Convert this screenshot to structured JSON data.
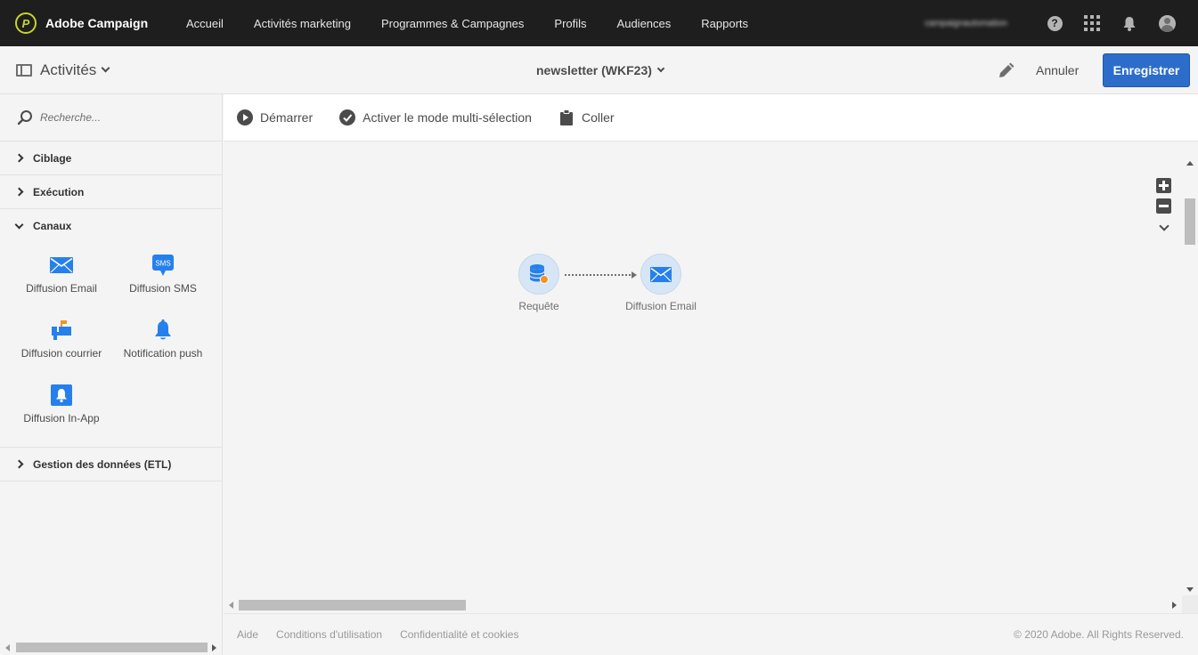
{
  "app": {
    "brand": "Adobe Campaign",
    "user": "campaignautomation"
  },
  "nav": {
    "items": [
      "Accueil",
      "Activités marketing",
      "Programmes & Campagnes",
      "Profils",
      "Audiences",
      "Rapports"
    ]
  },
  "header": {
    "activities_label": "Activités",
    "workflow_title": "newsletter (WKF23)",
    "cancel_label": "Annuler",
    "save_label": "Enregistrer"
  },
  "sidebar": {
    "search_placeholder": "Recherche...",
    "categories": [
      {
        "label": "Ciblage",
        "expanded": false
      },
      {
        "label": "Exécution",
        "expanded": false
      },
      {
        "label": "Canaux",
        "expanded": true
      },
      {
        "label": "Gestion des données (ETL)",
        "expanded": false
      }
    ],
    "channels": [
      {
        "label": "Diffusion Email",
        "icon": "envelope-icon"
      },
      {
        "label": "Diffusion SMS",
        "icon": "sms-icon"
      },
      {
        "label": "Diffusion courrier",
        "icon": "mailbox-icon"
      },
      {
        "label": "Notification push",
        "icon": "bell-icon"
      },
      {
        "label": "Diffusion In-App",
        "icon": "in-app-bell-icon"
      }
    ]
  },
  "toolbar": {
    "start_label": "Démarrer",
    "multiselect_label": "Activer le mode multi-sélection",
    "paste_label": "Coller"
  },
  "canvas": {
    "nodes": [
      {
        "label": "Requête",
        "icon": "database-icon"
      },
      {
        "label": "Diffusion Email",
        "icon": "envelope-icon"
      }
    ]
  },
  "footer": {
    "links": [
      "Aide",
      "Conditions d'utilisation",
      "Confidentialité et cookies"
    ],
    "copyright": "© 2020 Adobe. All Rights Reserved."
  },
  "colors": {
    "topbar": "#1e1e1e",
    "accent_blue": "#2d6dca",
    "icon_blue": "#2680eb",
    "node_bg": "#d6e6f6",
    "warning_orange": "#f29423"
  }
}
